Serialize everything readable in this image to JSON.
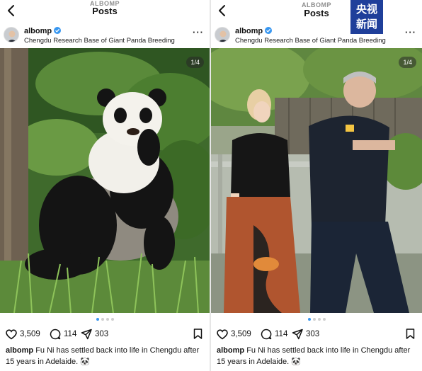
{
  "left": {
    "topbar": {
      "username": "ALBOMP",
      "title": "Posts"
    },
    "post": {
      "username": "albomp",
      "location": "Chengdu Research Base of Giant Panda Breeding",
      "slide_counter": "1/4",
      "slides": 4,
      "active_slide": 1,
      "likes": "3,509",
      "comments": "114",
      "shares": "303",
      "caption_user": "albomp",
      "caption_text": "Fu Ni has settled back into life in Chengdu after 15 years in Adelaide. 🐼"
    }
  },
  "right": {
    "topbar": {
      "username": "ALBOMP",
      "title": "Posts"
    },
    "watermark": {
      "line1": "央视",
      "line2": "新闻",
      "color": "#1f3f9a"
    },
    "post": {
      "username": "albomp",
      "location": "Chengdu Research Base of Giant Panda Breeding",
      "slide_counter": "1/4",
      "slides": 4,
      "active_slide": 1,
      "likes": "3,509",
      "comments": "114",
      "shares": "303",
      "caption_user": "albomp",
      "caption_text": "Fu Ni has settled back into life in Chengdu after 15 years in Adelaide. 🐼"
    }
  },
  "icons": [
    "back-icon",
    "verified-icon",
    "more-icon",
    "heart-icon",
    "comment-icon",
    "share-icon",
    "bookmark-icon"
  ],
  "colors": {
    "verified": "#3897f0",
    "active_dot": "#3897f0"
  }
}
